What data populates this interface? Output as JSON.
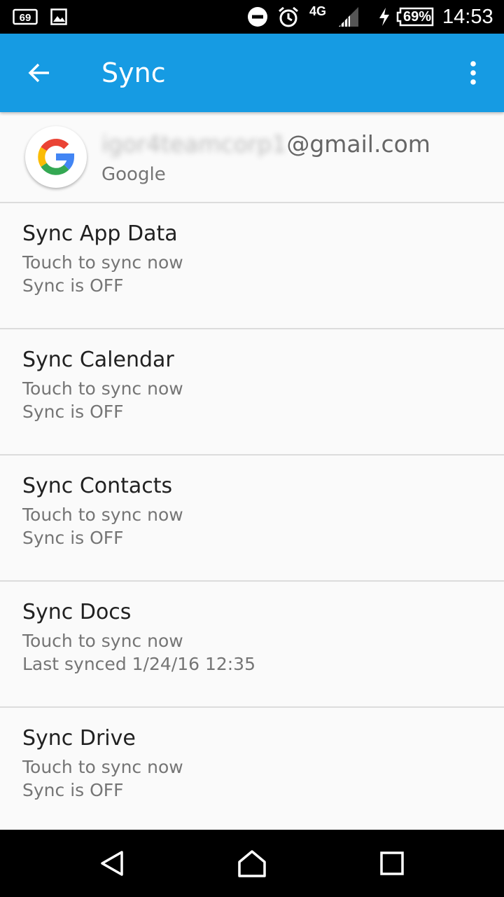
{
  "status_bar": {
    "notification_count": "69",
    "network_type": "4G",
    "battery_percent": "69%",
    "time": "14:53",
    "icons": [
      "notification-badge-icon",
      "image-icon",
      "dnd-icon",
      "alarm-icon",
      "signal-icon",
      "charging-icon",
      "battery-icon"
    ]
  },
  "app_bar": {
    "title": "Sync",
    "back_icon": "arrow-back-icon",
    "menu_icon": "more-vert-icon",
    "color": "#169be3"
  },
  "account": {
    "email_user": "igor4teamcorp1",
    "email_domain": "@gmail.com",
    "type": "Google",
    "logo_icon": "google-logo-icon"
  },
  "sync_items": [
    {
      "name": "Sync App Data",
      "action": "Touch to sync now",
      "status": "Sync is OFF"
    },
    {
      "name": "Sync Calendar",
      "action": "Touch to sync now",
      "status": "Sync is OFF"
    },
    {
      "name": "Sync Contacts",
      "action": "Touch to sync now",
      "status": "Sync is OFF"
    },
    {
      "name": "Sync Docs",
      "action": "Touch to sync now",
      "status": "Last synced 1/24/16 12:35"
    },
    {
      "name": "Sync Drive",
      "action": "Touch to sync now",
      "status": "Sync is OFF"
    }
  ],
  "nav_bar": {
    "icons": [
      "back-triangle-icon",
      "home-icon",
      "recents-icon"
    ]
  }
}
